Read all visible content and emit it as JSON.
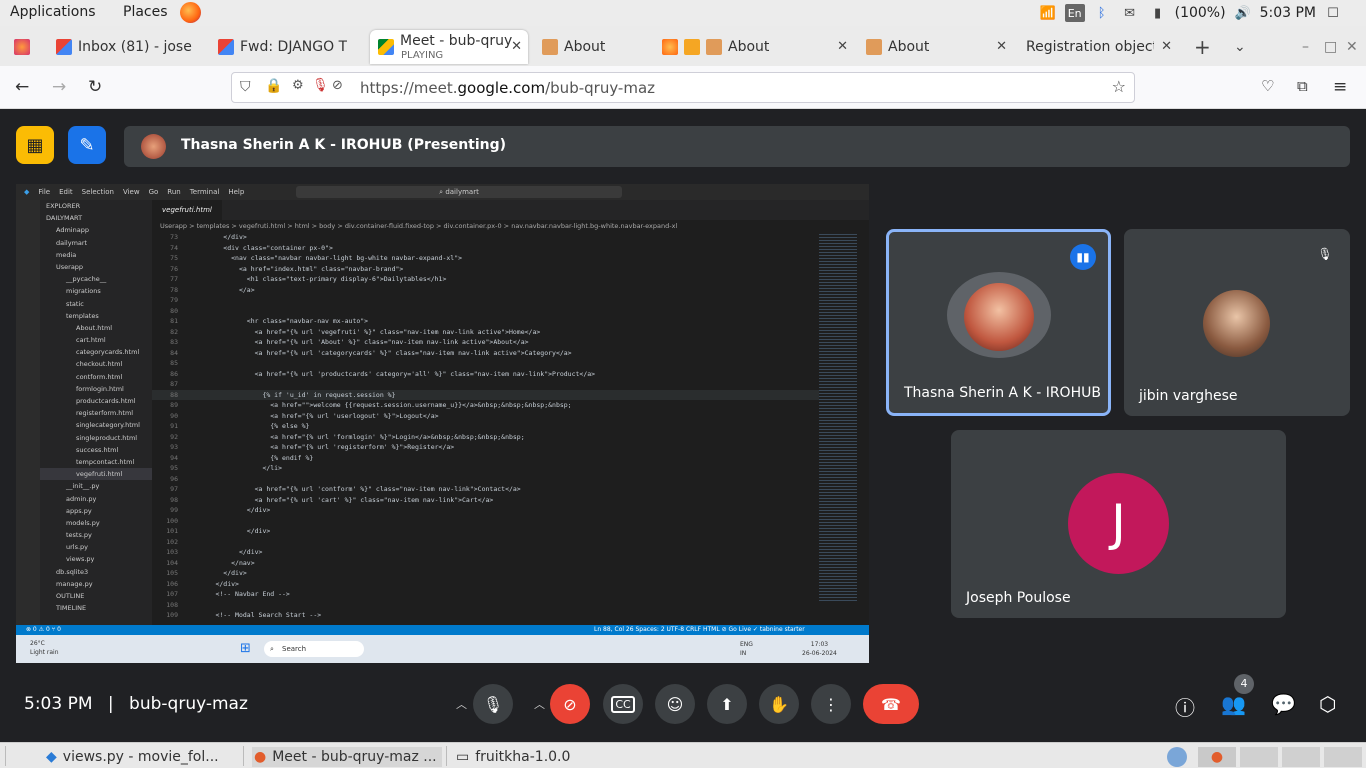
{
  "system_bar": {
    "applications": "Applications",
    "places": "Places",
    "language": "En",
    "battery": "(100%)",
    "time": "5:03 PM"
  },
  "tabs": [
    {
      "label": "Inbox (81) - jose"
    },
    {
      "label": "Fwd: DJANGO T"
    },
    {
      "label": "Meet - bub-qruy",
      "sub": "PLAYING"
    },
    {
      "label": "About"
    },
    {
      "label": "About"
    },
    {
      "label": "About"
    },
    {
      "label": "Registration object"
    }
  ],
  "browser": {
    "url_prefix": "https://meet.",
    "url_domain": "google.com",
    "url_path": "/bub-qruy-maz"
  },
  "meet": {
    "presenting": "Thasna Sherin A K - IROHUB (Presenting)",
    "time": "5:03 PM",
    "separator": "|",
    "code": "bub-qruy-maz",
    "people_count": "4",
    "participants": [
      {
        "name": "Thasna Sherin A K - IROHUB"
      },
      {
        "name": "jibin varghese"
      },
      {
        "name": "Joseph Poulose",
        "initial": "J"
      }
    ]
  },
  "shared_screen": {
    "menu": [
      "File",
      "Edit",
      "Selection",
      "View",
      "Go",
      "Run",
      "Terminal",
      "Help"
    ],
    "search": "dailymart",
    "tab": "vegefruti.html",
    "breadcrumb": "Userapp > templates > vegefruti.html > html > body > div.container-fluid.fixed-top > div.container.px-0 > nav.navbar.navbar-light.bg-white.navbar-expand-xl",
    "explorer": [
      "EXPLORER",
      "DAILYMART",
      "Adminapp",
      "dailymart",
      "media",
      "Userapp",
      "__pycache__",
      "migrations",
      "static",
      "templates",
      "About.html",
      "cart.html",
      "categorycards.html",
      "checkout.html",
      "contform.html",
      "formlogin.html",
      "productcards.html",
      "registerform.html",
      "singlecategory.html",
      "singleproduct.html",
      "success.html",
      "tempcontact.html",
      "vegefruti.html",
      "__init__.py",
      "admin.py",
      "apps.py",
      "models.py",
      "tests.py",
      "urls.py",
      "views.py",
      "db.sqlite3",
      "manage.py",
      "OUTLINE",
      "TIMELINE"
    ],
    "code": [
      {
        "n": "73",
        "t": "        </div>"
      },
      {
        "n": "74",
        "t": "        <div class=\"container px-0\">"
      },
      {
        "n": "75",
        "t": "          <nav class=\"navbar navbar-light bg-white navbar-expand-xl\">"
      },
      {
        "n": "76",
        "t": "            <a href=\"index.html\" class=\"navbar-brand\">"
      },
      {
        "n": "77",
        "t": "              <h1 class=\"text-primary display-6\">Dailytables</h1>"
      },
      {
        "n": "78",
        "t": "            </a>"
      },
      {
        "n": "79",
        "t": ""
      },
      {
        "n": "80",
        "t": ""
      },
      {
        "n": "81",
        "t": "              <hr class=\"navbar-nav mx-auto\">"
      },
      {
        "n": "82",
        "t": "                <a href=\"{% url 'vegefruti' %}\" class=\"nav-item nav-link active\">Home</a>"
      },
      {
        "n": "83",
        "t": "                <a href=\"{% url 'About' %}\" class=\"nav-item nav-link active\">About</a>"
      },
      {
        "n": "84",
        "t": "                <a href=\"{% url 'categorycards' %}\" class=\"nav-item nav-link active\">Category</a>"
      },
      {
        "n": "85",
        "t": ""
      },
      {
        "n": "86",
        "t": "                <a href=\"{% url 'productcards' category='all' %}\" class=\"nav-item nav-link\">Product</a>"
      },
      {
        "n": "87",
        "t": ""
      },
      {
        "n": "88",
        "t": "                  {% if 'u_id' in request.session %}"
      },
      {
        "n": "89",
        "t": "                    <a href=\"\">welcome {{request.session.username_u}}</a>&nbsp;&nbsp;&nbsp;&nbsp;"
      },
      {
        "n": "90",
        "t": "                    <a href=\"{% url 'userlogout' %}\">Logout</a>"
      },
      {
        "n": "91",
        "t": "                    {% else %}"
      },
      {
        "n": "92",
        "t": "                    <a href=\"{% url 'formlogin' %}\">Login</a>&nbsp;&nbsp;&nbsp;&nbsp;"
      },
      {
        "n": "93",
        "t": "                    <a href=\"{% url 'registerform' %}\">Register</a>"
      },
      {
        "n": "94",
        "t": "                    {% endif %}"
      },
      {
        "n": "95",
        "t": "                  </li>"
      },
      {
        "n": "96",
        "t": ""
      },
      {
        "n": "97",
        "t": "                <a href=\"{% url 'contform' %}\" class=\"nav-item nav-link\">Contact</a>"
      },
      {
        "n": "98",
        "t": "                <a href=\"{% url 'cart' %}\" class=\"nav-item nav-link\">Cart</a>"
      },
      {
        "n": "99",
        "t": "              </div>"
      },
      {
        "n": "100",
        "t": ""
      },
      {
        "n": "101",
        "t": "              </div>"
      },
      {
        "n": "102",
        "t": ""
      },
      {
        "n": "103",
        "t": "            </div>"
      },
      {
        "n": "104",
        "t": "          </nav>"
      },
      {
        "n": "105",
        "t": "        </div>"
      },
      {
        "n": "106",
        "t": "      </div>"
      },
      {
        "n": "107",
        "t": "      <!-- Navbar End -->"
      },
      {
        "n": "108",
        "t": ""
      },
      {
        "n": "109",
        "t": "      <!-- Modal Search Start -->"
      }
    ],
    "status_left": "⊗ 0 ⚠ 0   ⑂ 0",
    "status_right": "Ln 88, Col 26   Spaces: 2   UTF-8   CRLF   HTML   ⊘ Go Live   ✓ tabnine starter",
    "weather": "26°C\nLight rain",
    "win_search": "Search",
    "win_lang": "ENG\nIN",
    "win_clock": "17:03\n26-06-2024"
  },
  "os_taskbar": [
    {
      "label": "views.py - movie_fol..."
    },
    {
      "label": "Meet - bub-qruy-maz ..."
    },
    {
      "label": "fruitkha-1.0.0"
    }
  ]
}
